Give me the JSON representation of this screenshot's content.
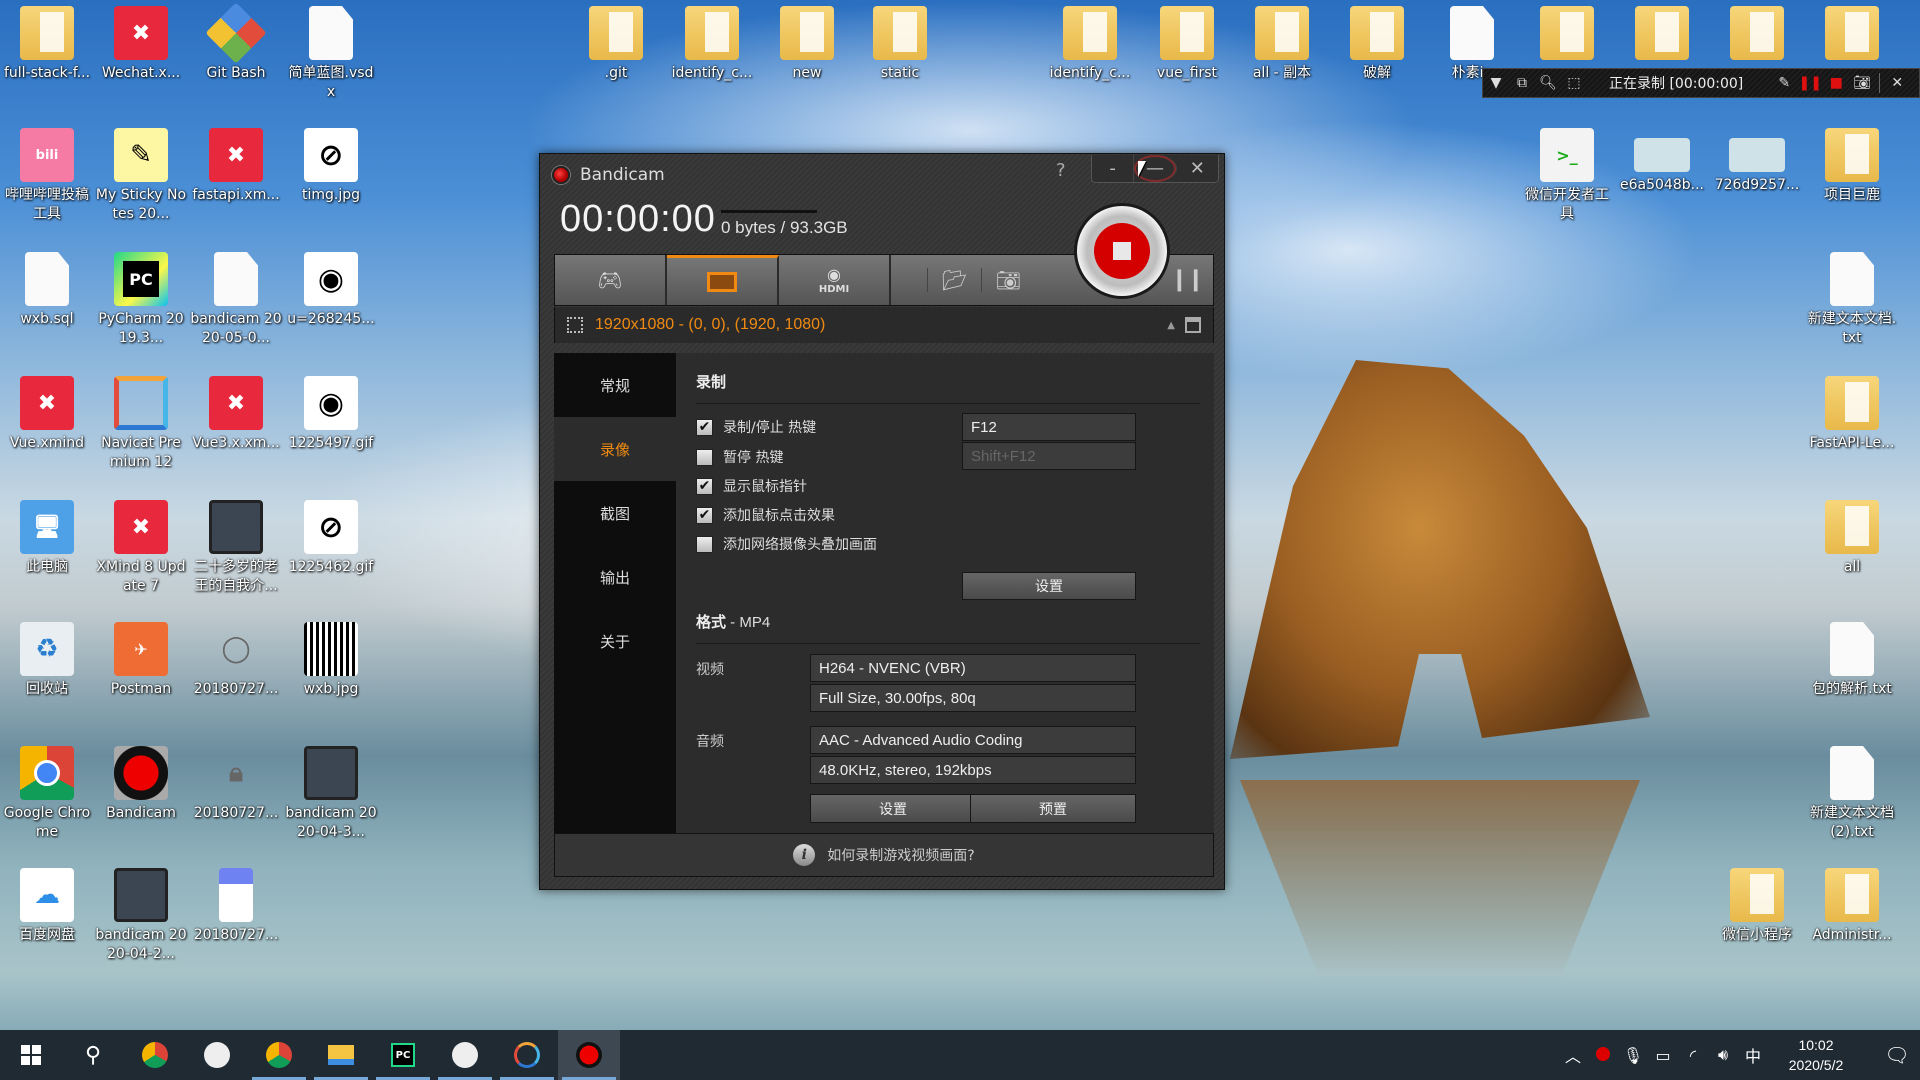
{
  "desktop": {
    "icons_left": [
      {
        "label": "full-stack-f...",
        "type": "folder"
      },
      {
        "label": "Wechat.x...",
        "type": "xmind"
      },
      {
        "label": "Git Bash",
        "type": "gitbash"
      },
      {
        "label": "简单蓝图.vsdx",
        "type": "file"
      },
      {
        "label": "哔哩哔哩投稿工具",
        "type": "bili"
      },
      {
        "label": "My Sticky Notes 20...",
        "type": "sticky"
      },
      {
        "label": "fastapi.xm...",
        "type": "xmind"
      },
      {
        "label": "timg.jpg",
        "type": "eye-off-image"
      },
      {
        "label": "wxb.sql",
        "type": "file"
      },
      {
        "label": "PyCharm 2019.3...",
        "type": "pycharm"
      },
      {
        "label": "bandicam 2020-05-0...",
        "type": "media"
      },
      {
        "label": "u=268245...",
        "type": "eye-image"
      },
      {
        "label": "Vue.xmind",
        "type": "xmind"
      },
      {
        "label": "Navicat Premium 12",
        "type": "navicat"
      },
      {
        "label": "Vue3.x.xm...",
        "type": "xmind"
      },
      {
        "label": "1225497.gif",
        "type": "eye-image"
      },
      {
        "label": "此电脑",
        "type": "pc"
      },
      {
        "label": "XMind 8 Update 7",
        "type": "xmind"
      },
      {
        "label": "二十多岁的老王的自我介...",
        "type": "video"
      },
      {
        "label": "1225462.gif",
        "type": "eye-off-image"
      },
      {
        "label": "回收站",
        "type": "recycle"
      },
      {
        "label": "Postman",
        "type": "postman"
      },
      {
        "label": "20180727...",
        "type": "user-image"
      },
      {
        "label": "wxb.jpg",
        "type": "qr"
      },
      {
        "label": "Google Chrome",
        "type": "chrome"
      },
      {
        "label": "Bandicam",
        "type": "bandicam"
      },
      {
        "label": "20180727...",
        "type": "lock-image"
      },
      {
        "label": "bandicam 2020-04-3...",
        "type": "video"
      },
      {
        "label": "百度网盘",
        "type": "baidu"
      },
      {
        "label": "bandicam 2020-04-2...",
        "type": "video"
      },
      {
        "label": "20180727...",
        "type": "blue-image"
      }
    ],
    "icons_top": [
      {
        "label": ".git",
        "type": "folder"
      },
      {
        "label": "identify_c...",
        "type": "folder"
      },
      {
        "label": "new",
        "type": "folder"
      },
      {
        "label": "static",
        "type": "folder"
      },
      {
        "label": "identify_c...",
        "type": "folder"
      },
      {
        "label": "vue_first",
        "type": "folder"
      },
      {
        "label": "all - 副本",
        "type": "folder"
      },
      {
        "label": "破解",
        "type": "folder"
      },
      {
        "label": "朴素ip",
        "type": "file"
      }
    ],
    "icons_right": [
      {
        "label": "微信开发者工具",
        "type": "wechatdev"
      },
      {
        "label": "e6a5048b...",
        "type": "idcard"
      },
      {
        "label": "726d9257...",
        "type": "idcard"
      },
      {
        "label": "项目巨鹿",
        "type": "folder"
      },
      {
        "label": "新建文本文档.txt",
        "type": "file"
      },
      {
        "label": "FastAPI-Le...",
        "type": "folder"
      },
      {
        "label": "all",
        "type": "folder"
      },
      {
        "label": "包的解析.txt",
        "type": "file"
      },
      {
        "label": "新建文本文档 (2).txt",
        "type": "file"
      },
      {
        "label": "微信小程序",
        "type": "folder"
      },
      {
        "label": "Administr...",
        "type": "folder"
      }
    ]
  },
  "recording_toolbar": {
    "status": "正在录制 [00:00:00]",
    "icons": [
      "dropdown-icon",
      "window-icon",
      "zoom-icon",
      "region-icon",
      "pencil-icon",
      "pause-icon",
      "stop-icon",
      "camera-icon",
      "close-icon"
    ]
  },
  "bandicam": {
    "title": "Bandicam",
    "help": "?",
    "controls": {
      "mini": "-",
      "minimize": "—",
      "close": "✕"
    },
    "timer": "00:00:00",
    "size": "0 bytes / 93.3GB",
    "modes": [
      "game-mode",
      "screen-mode",
      "device-mode"
    ],
    "hdmi_label": "HDMI",
    "region": "1920x1080 - (0, 0), (1920, 1080)",
    "sidebar": [
      {
        "label": "常规",
        "active": false
      },
      {
        "label": "录像",
        "active": true
      },
      {
        "label": "截图",
        "active": false
      },
      {
        "label": "输出",
        "active": false
      },
      {
        "label": "关于",
        "active": false
      }
    ],
    "record_section": {
      "title": "录制",
      "options": [
        {
          "label": "录制/停止 热键",
          "checked": true,
          "mark": "✔"
        },
        {
          "label": "暂停 热键",
          "checked": false,
          "mark": ""
        },
        {
          "label": "显示鼠标指针",
          "checked": true,
          "mark": "✔"
        },
        {
          "label": "添加鼠标点击效果",
          "checked": true,
          "mark": "✔"
        },
        {
          "label": "添加网络摄像头叠加画面",
          "checked": false,
          "mark": ""
        }
      ],
      "hotkey_record": "F12",
      "hotkey_pause": "Shift+F12",
      "settings_button": "设置"
    },
    "format_section": {
      "title": "格式",
      "format": " - MP4",
      "video_label": "视频",
      "video_codec": "H264 - NVENC (VBR)",
      "video_detail": "Full Size, 30.00fps, 80q",
      "audio_label": "音频",
      "audio_codec": "AAC - Advanced Audio Coding",
      "audio_detail": "48.0KHz, stereo, 192kbps",
      "settings_button": "设置",
      "presets_button": "预置"
    },
    "footer_link": "如何录制游戏视频画面?"
  },
  "taskbar": {
    "apps": [
      "start",
      "search",
      "chrome",
      "wechat-devtools",
      "chrome",
      "file-explorer",
      "pycharm",
      "wechat-devtools",
      "navicat",
      "bandicam"
    ],
    "time": "10:02",
    "date": "2020/5/2",
    "ime": "中"
  },
  "colors": {
    "accent": "#f08a12",
    "record_red": "#d40000",
    "taskbar": "#1f2a33"
  }
}
